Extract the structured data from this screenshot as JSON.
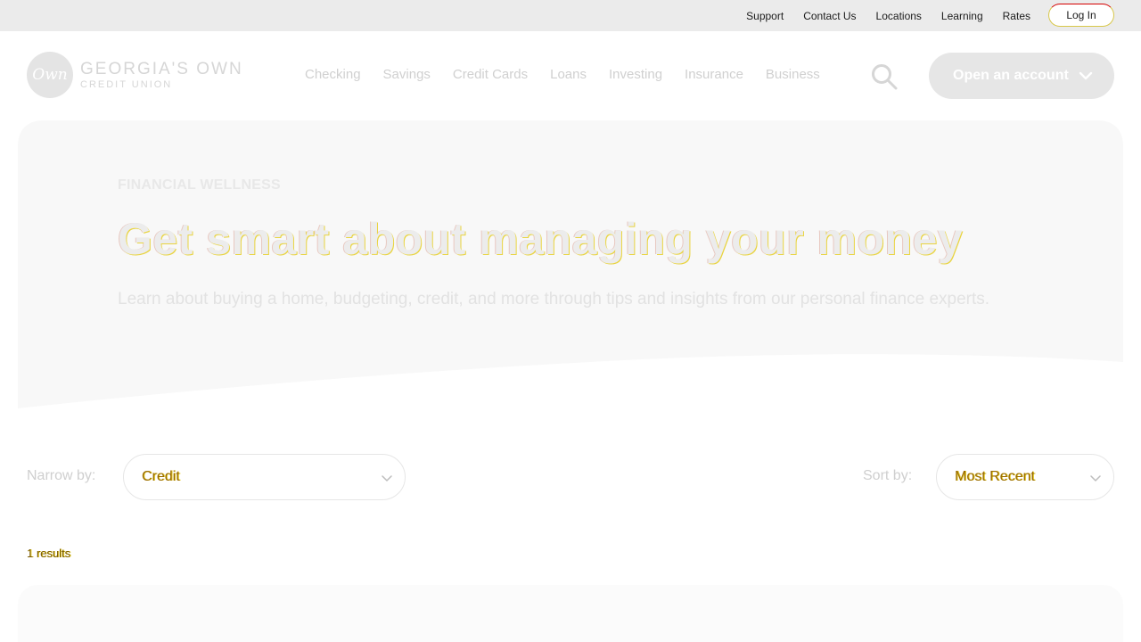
{
  "utility_bar": {
    "links": [
      "Support",
      "Contact Us",
      "Locations",
      "Learning",
      "Rates"
    ],
    "login_label": "Log In"
  },
  "header": {
    "logo_mark": "Own",
    "logo_line1": "GEORGIA'S OWN",
    "logo_line2": "CREDIT UNION",
    "nav": [
      "Checking",
      "Savings",
      "Credit Cards",
      "Loans",
      "Investing",
      "Insurance",
      "Business"
    ],
    "search_icon": "search-icon",
    "open_account_label": "Open an account"
  },
  "hero": {
    "eyebrow": "FINANCIAL WELLNESS",
    "title": "Get smart about managing your money",
    "subtitle": "Learn about buying a home, budgeting, credit, and more through tips and insights from our personal finance experts."
  },
  "filters": {
    "narrow_label": "Narrow by:",
    "narrow_value": "Credit",
    "sort_label": "Sort by:",
    "sort_value": "Most Recent"
  },
  "results_text": "1 results",
  "colors": {
    "utility_bg": "#ebebeb",
    "button_bg": "#e6e6e6",
    "hero_bg": "#f8f8f8"
  }
}
